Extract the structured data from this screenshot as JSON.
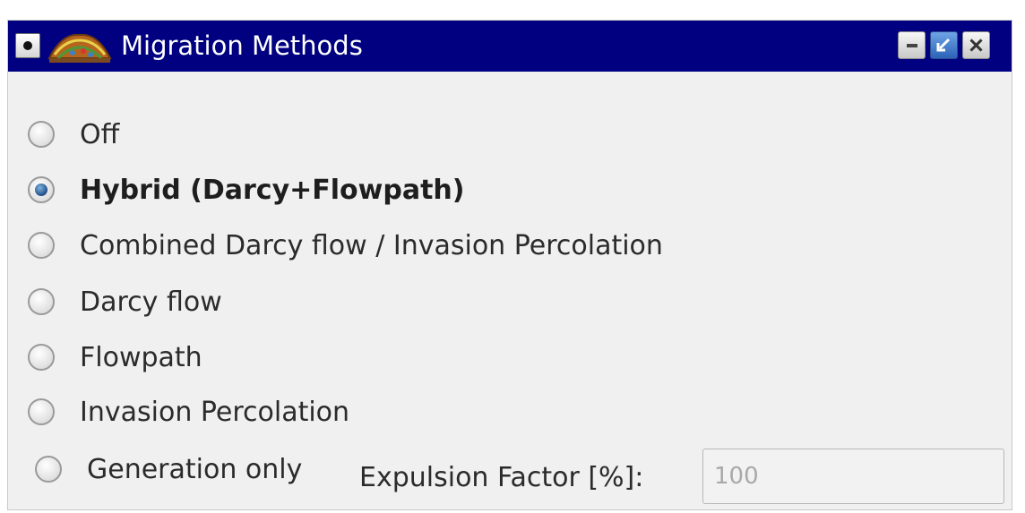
{
  "window": {
    "title": "Migration Methods",
    "title_bar_color": "#000080",
    "icons": {
      "system_menu": "window-menu-icon",
      "app": "migration-app-icon",
      "minimize": "minimize-icon",
      "restore": "restore-icon",
      "close": "close-icon"
    }
  },
  "migration_methods": {
    "options": [
      {
        "label": "Off",
        "selected": false
      },
      {
        "label": "Hybrid (Darcy+Flowpath)",
        "selected": true
      },
      {
        "label": "Combined Darcy flow / Invasion Percolation",
        "selected": false
      },
      {
        "label": "Darcy flow",
        "selected": false
      },
      {
        "label": "Flowpath",
        "selected": false
      },
      {
        "label": "Invasion Percolation",
        "selected": false
      },
      {
        "label": "Generation only",
        "selected": false
      }
    ],
    "selected_value": "Hybrid (Darcy+Flowpath)"
  },
  "expulsion": {
    "label": "Expulsion Factor [%]:",
    "value": "100"
  }
}
